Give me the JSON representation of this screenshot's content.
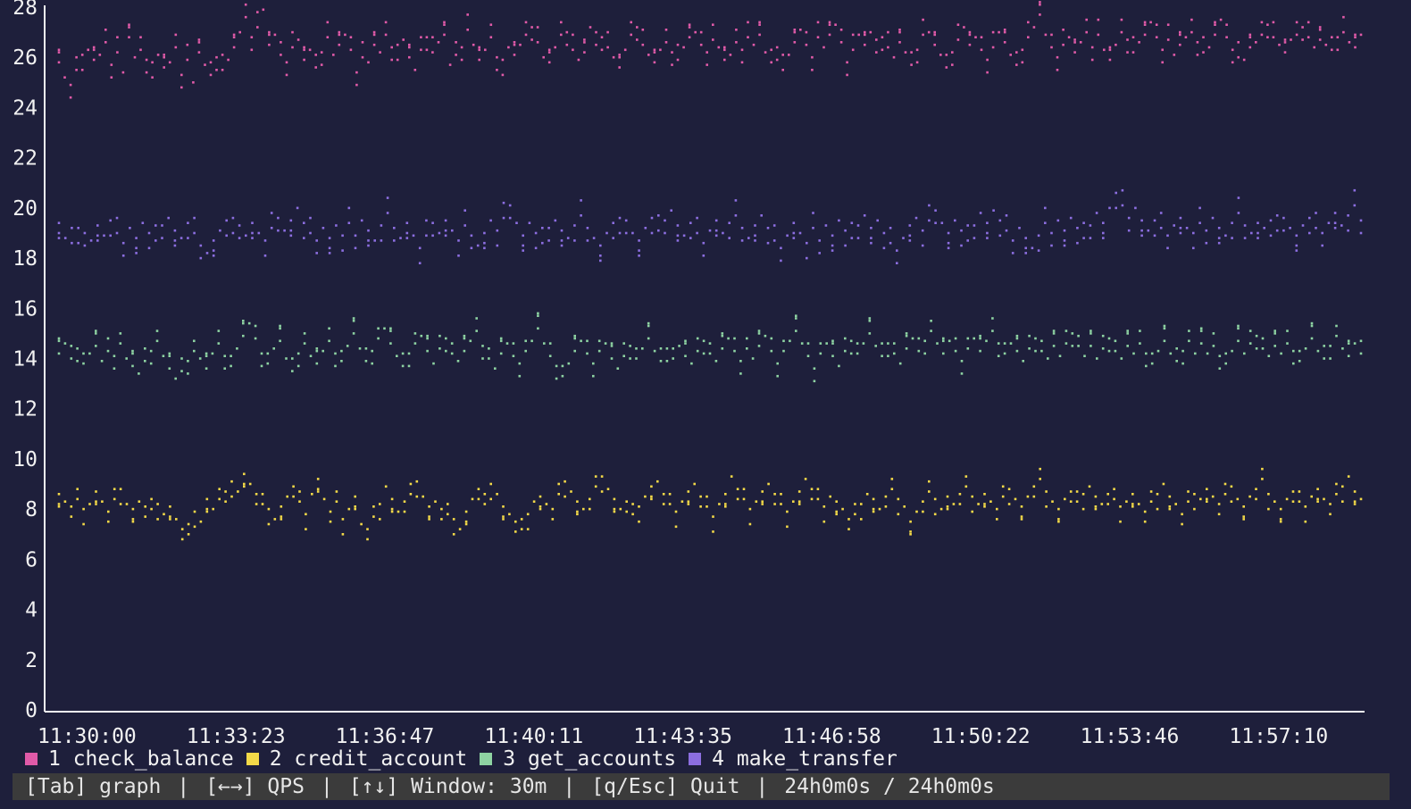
{
  "colors": {
    "background": "#1e1f3b",
    "axis": "#f2f2f2",
    "statusbar_bg": "#3b3b3b"
  },
  "chart_data": {
    "type": "scatter",
    "ylim": [
      0,
      28
    ],
    "y_ticks": [
      "0",
      "2",
      "4",
      "6",
      "8",
      "10",
      "12",
      "14",
      "16",
      "18",
      "20",
      "22",
      "24",
      "26",
      "28"
    ],
    "x_ticks": [
      "11:30:00",
      "11:33:23",
      "11:36:47",
      "11:40:11",
      "11:43:35",
      "11:46:58",
      "11:50:22",
      "11:53:46",
      "11:57:10"
    ],
    "series": [
      {
        "name": "1 check_balance",
        "color": "#e05aa8",
        "values": [
          25.8,
          25.2,
          24.4,
          26.0,
          25.5,
          26.3,
          25.9,
          26.1,
          26.6,
          25.7,
          26.2,
          25.4,
          26.8,
          26.0,
          26.3,
          25.9,
          25.2,
          26.1,
          25.6,
          25.8,
          26.4,
          25.3,
          25.9,
          25.0,
          26.2,
          25.7,
          25.3,
          26.0,
          25.5,
          25.9,
          26.4,
          27.0,
          27.6,
          26.8,
          27.2,
          27.9,
          26.5,
          26.9,
          26.1,
          25.8,
          26.4,
          26.7,
          25.9,
          26.3,
          25.6,
          26.2,
          26.8,
          26.1,
          26.5,
          26.9,
          26.3,
          25.4,
          26.0,
          25.8,
          26.5,
          26.2,
          26.9,
          26.4,
          25.9,
          26.7,
          26.0,
          25.5,
          26.3,
          26.8,
          26.2,
          26.6,
          26.9,
          25.7,
          26.1,
          26.4,
          27.1,
          26.5,
          25.9,
          26.3,
          26.8,
          26.0,
          25.3,
          26.4,
          26.1,
          26.5,
          26.9,
          27.2,
          26.6,
          26.0,
          25.8,
          26.4,
          26.9,
          27.0,
          26.3,
          25.9,
          26.2,
          27.2,
          26.5,
          26.8,
          26.4,
          26.0,
          25.6,
          26.3,
          26.9,
          27.2,
          26.5,
          26.1,
          25.8,
          26.3,
          26.6,
          26.2,
          25.9,
          26.4,
          26.8,
          27.0,
          26.5,
          26.2,
          26.7,
          26.4,
          25.9,
          26.1,
          26.6,
          26.3,
          26.8,
          26.5,
          26.9,
          26.2,
          25.8,
          26.4,
          25.5,
          26.1,
          26.6,
          27.1,
          26.5,
          26.0,
          26.8,
          26.4,
          26.9,
          27.3,
          26.6,
          25.8,
          26.3,
          26.9,
          26.5,
          27.0,
          26.2,
          26.8,
          26.4,
          26.0,
          26.6,
          26.2,
          25.7,
          26.3,
          26.9,
          27.0,
          26.5,
          26.1,
          25.6,
          26.2,
          26.7,
          27.2,
          26.5,
          26.8,
          26.3,
          25.9,
          26.4,
          27.0,
          26.6,
          26.1,
          25.7,
          26.3,
          26.8,
          27.2,
          27.7,
          26.9,
          26.4,
          26.0,
          26.5,
          26.8,
          26.2,
          26.6,
          27.0,
          26.4,
          26.9,
          26.3,
          25.9,
          26.5,
          27.0,
          26.7,
          26.2,
          26.6,
          26.9,
          27.4,
          26.8,
          26.3,
          26.7,
          26.1,
          26.5,
          26.8,
          27.0,
          26.6,
          26.2,
          26.4,
          26.9,
          27.5,
          26.8,
          26.3,
          26.0,
          25.9,
          26.4,
          26.6,
          26.9,
          27.3,
          26.8,
          26.5,
          26.2,
          26.7,
          26.9,
          27.2,
          26.8,
          26.4,
          26.7,
          26.5,
          26.3,
          26.8,
          27.0,
          26.6,
          26.4,
          26.9
        ],
        "scatter_offsets": [
          [
            0,
            0.4
          ],
          [
            0,
            -0.6
          ],
          [
            0,
            0.5
          ],
          [
            0,
            -0.4
          ],
          [
            0,
            0.6
          ],
          [
            0,
            -0.5
          ]
        ]
      },
      {
        "name": "2 credit_account",
        "color": "#f3d948",
        "values": [
          8.6,
          8.3,
          8.1,
          8.4,
          8.0,
          8.2,
          8.7,
          8.3,
          7.9,
          8.4,
          8.8,
          8.2,
          8.0,
          8.3,
          8.1,
          8.0,
          8.2,
          7.8,
          8.1,
          7.6,
          7.2,
          7.0,
          7.9,
          7.5,
          8.4,
          8.0,
          8.8,
          8.3,
          9.1,
          8.7,
          9.4,
          9.0,
          8.6,
          8.2,
          8.0,
          7.6,
          8.1,
          8.5,
          8.9,
          8.3,
          7.8,
          8.6,
          9.2,
          8.4,
          7.9,
          8.3,
          7.6,
          8.0,
          8.5,
          7.4,
          7.2,
          7.7,
          8.2,
          8.9,
          8.4,
          7.9,
          8.3,
          8.6,
          9.1,
          8.5,
          8.1,
          8.3,
          8.0,
          7.8,
          7.6,
          7.2,
          7.9,
          8.4,
          8.8,
          8.2,
          9.0,
          8.6,
          8.1,
          7.8,
          7.5,
          7.2,
          7.8,
          8.3,
          8.5,
          8.2,
          8.0,
          8.6,
          9.1,
          8.7,
          8.3,
          8.0,
          8.4,
          8.9,
          9.3,
          8.8,
          8.4,
          8.0,
          8.3,
          7.8,
          8.1,
          8.5,
          8.9,
          9.1,
          8.6,
          8.2,
          7.9,
          8.3,
          8.7,
          9.0,
          8.5,
          8.1,
          7.7,
          8.2,
          8.6,
          9.3,
          8.8,
          8.4,
          8.0,
          8.3,
          8.7,
          9.0,
          8.6,
          8.2,
          7.9,
          8.3,
          8.7,
          9.2,
          8.8,
          8.4,
          8.1,
          8.5,
          8.3,
          8.0,
          7.6,
          7.8,
          8.2,
          8.6,
          8.4,
          8.0,
          8.5,
          8.8,
          8.4,
          8.1,
          7.5,
          7.9,
          8.3,
          8.7,
          8.4,
          8.0,
          8.5,
          8.2,
          8.6,
          8.9,
          8.5,
          8.2,
          8.6,
          8.3,
          8.0,
          8.5,
          8.8,
          8.4,
          8.1,
          8.5,
          8.9,
          9.2,
          8.7,
          8.3,
          8.0,
          8.4,
          8.7,
          8.3,
          8.6,
          8.9,
          8.5,
          8.2,
          8.6,
          8.4,
          8.1,
          8.3,
          8.6,
          8.2,
          7.9,
          8.3,
          8.6,
          9.0,
          8.5,
          8.2,
          7.8,
          8.3,
          8.6,
          8.4,
          8.8,
          8.5,
          8.2,
          8.6,
          8.9,
          8.4,
          8.1,
          8.5,
          8.8,
          9.2,
          8.6,
          8.3,
          8.0,
          8.4,
          8.7,
          8.3,
          8.1,
          8.5,
          8.8,
          8.4,
          8.2,
          8.6,
          8.9,
          9.3,
          8.7,
          8.4
        ],
        "scatter_offsets": [
          [
            0,
            0.4
          ],
          [
            0,
            -0.5
          ],
          [
            0,
            0.6
          ],
          [
            0,
            -0.4
          ],
          [
            0,
            0.5
          ],
          [
            0,
            -0.6
          ]
        ]
      },
      {
        "name": "3 get_accounts",
        "color": "#8ed3a2",
        "values": [
          14.2,
          14.6,
          14.0,
          14.4,
          13.8,
          14.2,
          14.5,
          13.9,
          14.3,
          14.1,
          14.6,
          14.0,
          13.7,
          13.4,
          13.9,
          14.3,
          14.7,
          14.1,
          13.6,
          13.2,
          13.5,
          13.9,
          14.3,
          14.0,
          13.6,
          14.2,
          14.6,
          14.1,
          13.7,
          14.4,
          14.9,
          15.4,
          14.8,
          14.2,
          13.8,
          14.4,
          14.7,
          14.0,
          13.5,
          14.2,
          14.6,
          14.1,
          13.8,
          14.3,
          14.7,
          14.2,
          13.9,
          14.5,
          15.0,
          14.4,
          13.9,
          14.3,
          14.8,
          15.2,
          14.6,
          14.1,
          13.7,
          14.2,
          14.6,
          14.9,
          14.3,
          13.8,
          14.4,
          14.8,
          14.2,
          13.9,
          14.3,
          14.7,
          15.1,
          14.5,
          14.0,
          13.6,
          14.2,
          14.6,
          14.1,
          13.8,
          14.3,
          14.7,
          15.2,
          14.6,
          14.1,
          13.7,
          13.3,
          13.8,
          14.3,
          14.7,
          14.2,
          13.8,
          14.3,
          14.6,
          14.0,
          13.6,
          14.1,
          14.5,
          14.0,
          14.4,
          14.8,
          14.3,
          13.9,
          14.4,
          14.0,
          14.5,
          14.1,
          13.8,
          14.3,
          14.7,
          14.2,
          13.9,
          14.4,
          14.8,
          14.3,
          13.9,
          14.4,
          14.0,
          14.5,
          14.9,
          14.3,
          13.8,
          14.3,
          14.7,
          15.1,
          14.6,
          14.1,
          13.6,
          14.2,
          14.6,
          14.1,
          13.7,
          14.3,
          14.7,
          14.2,
          14.6,
          15.0,
          14.5,
          14.1,
          14.6,
          14.2,
          13.8,
          14.4,
          14.8,
          14.3,
          14.7,
          15.1,
          14.6,
          14.2,
          14.7,
          14.3,
          13.9,
          14.4,
          14.8,
          14.3,
          14.7,
          15.1,
          14.6,
          14.2,
          14.6,
          14.3,
          13.9,
          14.4,
          14.8,
          14.3,
          14.0,
          14.5,
          14.1,
          14.6,
          15.0,
          14.5,
          14.1,
          14.5,
          14.0,
          14.4,
          14.8,
          14.3,
          14.0,
          14.5,
          14.2,
          14.6,
          14.2,
          13.8,
          14.3,
          14.7,
          14.2,
          13.9,
          14.3,
          14.7,
          14.2,
          14.6,
          14.2,
          14.5,
          14.1,
          13.8,
          14.3,
          14.7,
          14.2,
          14.6,
          14.9,
          14.4,
          14.1,
          14.5,
          14.2,
          14.6,
          14.3,
          13.9,
          14.4,
          14.8,
          14.3,
          14.0,
          14.5,
          14.9,
          14.4,
          14.1,
          14.6,
          14.2
        ],
        "scatter_offsets": [
          [
            0,
            0.4
          ],
          [
            0,
            -0.5
          ],
          [
            0,
            0.6
          ],
          [
            0,
            -0.4
          ],
          [
            0,
            0.5
          ],
          [
            0,
            -0.6
          ]
        ]
      },
      {
        "name": "4 make_transfer",
        "color": "#8c6ee0",
        "values": [
          19.4,
          18.8,
          19.2,
          18.6,
          19.0,
          18.7,
          19.3,
          18.9,
          19.5,
          19.0,
          18.6,
          19.2,
          18.8,
          19.4,
          19.0,
          18.7,
          19.3,
          19.6,
          19.1,
          18.8,
          19.4,
          19.0,
          18.5,
          18.2,
          18.7,
          19.1,
          19.5,
          19.0,
          19.3,
          18.9,
          19.4,
          19.0,
          18.7,
          19.2,
          19.6,
          19.1,
          19.5,
          20.0,
          19.4,
          19.0,
          18.7,
          19.2,
          18.8,
          19.3,
          18.9,
          19.4,
          18.9,
          19.5,
          19.1,
          18.7,
          19.3,
          19.8,
          19.2,
          18.8,
          19.4,
          18.9,
          18.4,
          18.9,
          19.4,
          19.0,
          19.5,
          19.1,
          18.7,
          19.3,
          18.9,
          18.5,
          19.0,
          19.5,
          19.1,
          19.6,
          20.1,
          19.4,
          18.9,
          19.4,
          19.0,
          18.6,
          19.2,
          19.5,
          19.1,
          18.8,
          19.3,
          19.7,
          19.2,
          18.8,
          18.5,
          19.0,
          19.4,
          19.0,
          19.5,
          19.0,
          18.7,
          19.2,
          19.6,
          19.1,
          19.5,
          19.9,
          19.3,
          18.9,
          19.4,
          19.0,
          18.6,
          19.1,
          19.5,
          19.0,
          19.4,
          19.7,
          19.2,
          18.8,
          19.3,
          19.7,
          19.2,
          18.7,
          18.4,
          18.9,
          19.4,
          19.0,
          18.6,
          19.2,
          18.7,
          19.3,
          18.9,
          19.5,
          19.1,
          18.8,
          19.3,
          19.7,
          19.2,
          19.5,
          19.0,
          18.6,
          18.3,
          18.8,
          19.3,
          19.6,
          19.1,
          19.5,
          19.9,
          19.4,
          19.0,
          19.5,
          19.1,
          18.7,
          19.3,
          19.8,
          19.4,
          19.9,
          19.5,
          19.1,
          18.7,
          19.2,
          18.8,
          18.4,
          18.9,
          19.4,
          19.0,
          19.5,
          19.1,
          19.6,
          19.2,
          18.8,
          19.3,
          19.8,
          19.4,
          20.0,
          20.6,
          20.1,
          19.6,
          20.0,
          19.5,
          19.1,
          19.5,
          19.2,
          18.9,
          19.3,
          19.6,
          19.2,
          19.0,
          19.4,
          19.1,
          19.6,
          19.2,
          18.9,
          19.4,
          19.8,
          19.3,
          19.0,
          19.4,
          19.2,
          19.5,
          19.1,
          19.6,
          19.2,
          18.9,
          19.3,
          19.6,
          19.2,
          19.0,
          19.4,
          19.8,
          19.3,
          19.7,
          20.1,
          19.5
        ],
        "scatter_offsets": [
          [
            0,
            0.4
          ],
          [
            0,
            -0.5
          ],
          [
            0,
            0.6
          ],
          [
            0,
            -0.4
          ],
          [
            0,
            0.5
          ],
          [
            0,
            -0.6
          ]
        ]
      }
    ],
    "grid": false,
    "legend_position": "bottom-left"
  },
  "legend": {
    "items": [
      {
        "label": "1 check_balance",
        "color": "#e05aa8"
      },
      {
        "label": "2 credit_account",
        "color": "#f3d948"
      },
      {
        "label": "3 get_accounts",
        "color": "#8ed3a2"
      },
      {
        "label": "4 make_transfer",
        "color": "#8c6ee0"
      }
    ]
  },
  "statusbar": {
    "tab": "[Tab] graph",
    "qps": "[←→] QPS",
    "window": "[↑↓] Window: 30m",
    "quit": "[q/Esc] Quit",
    "elapsed": "24h0m0s / 24h0m0s",
    "separator": "|"
  }
}
